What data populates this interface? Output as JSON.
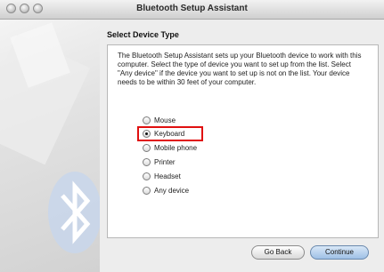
{
  "window": {
    "title": "Bluetooth Setup Assistant"
  },
  "page": {
    "section_title": "Select Device Type",
    "description": "The Bluetooth Setup Assistant sets up your Bluetooth device to work with this computer. Select the type of device you want to set up from the list. Select \"Any device\" if the device you want to set up is not on the list. Your device needs to be within 30 feet of your computer."
  },
  "device_types": [
    {
      "label": "Mouse",
      "selected": false
    },
    {
      "label": "Keyboard",
      "selected": true
    },
    {
      "label": "Mobile phone",
      "selected": false
    },
    {
      "label": "Printer",
      "selected": false
    },
    {
      "label": "Headset",
      "selected": false
    },
    {
      "label": "Any device",
      "selected": false
    }
  ],
  "buttons": {
    "back": "Go Back",
    "continue": "Continue"
  },
  "icons": {
    "sidebar_logo": "bluetooth-icon"
  },
  "colors": {
    "highlight": "#e01010",
    "default_button": "#9fc0e6"
  }
}
